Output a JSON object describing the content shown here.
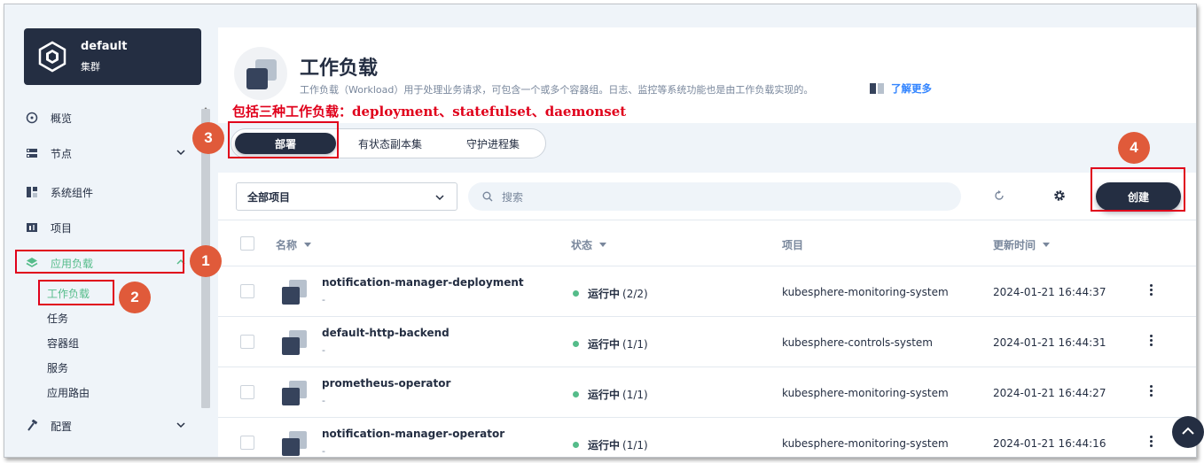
{
  "sidebar": {
    "cluster_name": "default",
    "cluster_sub": "集群",
    "items": [
      {
        "label": "概览"
      },
      {
        "label": "节点"
      },
      {
        "label": "系统组件"
      },
      {
        "label": "项目"
      },
      {
        "label": "应用负载"
      },
      {
        "label": "配置"
      }
    ],
    "sub_items": [
      {
        "label": "工作负载"
      },
      {
        "label": "任务"
      },
      {
        "label": "容器组"
      },
      {
        "label": "服务"
      },
      {
        "label": "应用路由"
      }
    ]
  },
  "header": {
    "title": "工作负载",
    "description": "工作负载（Workload）用于处理业务请求，可包含一个或多个容器组。日志、监控等系统功能也是由工作负载实现的。",
    "learn_more": "了解更多"
  },
  "annotation": {
    "note": "包括三种工作负载：deployment、statefulset、daemonset",
    "badges": [
      "1",
      "2",
      "3",
      "4"
    ]
  },
  "tabs": [
    {
      "label": "部署"
    },
    {
      "label": "有状态副本集"
    },
    {
      "label": "守护进程集"
    }
  ],
  "toolbar": {
    "project_select": "全部项目",
    "search_placeholder": "搜索",
    "create_label": "创建"
  },
  "table": {
    "headers": [
      "名称",
      "状态",
      "项目",
      "更新时间"
    ],
    "rows": [
      {
        "name": "notification-manager-deployment",
        "sub": "-",
        "status": "运行中",
        "count": "(2/2)",
        "project": "kubesphere-monitoring-system",
        "updated": "2024-01-21 16:44:37"
      },
      {
        "name": "default-http-backend",
        "sub": "-",
        "status": "运行中",
        "count": "(1/1)",
        "project": "kubesphere-controls-system",
        "updated": "2024-01-21 16:44:31"
      },
      {
        "name": "prometheus-operator",
        "sub": "-",
        "status": "运行中",
        "count": "(1/1)",
        "project": "kubesphere-monitoring-system",
        "updated": "2024-01-21 16:44:27"
      },
      {
        "name": "notification-manager-operator",
        "sub": "-",
        "status": "运行中",
        "count": "(1/1)",
        "project": "kubesphere-monitoring-system",
        "updated": "2024-01-21 16:44:16"
      }
    ]
  },
  "colors": {
    "accent_green": "#55bc8a",
    "dark": "#242e42",
    "annotation_red": "#e0001b",
    "badge_orange": "#e05a3a"
  }
}
